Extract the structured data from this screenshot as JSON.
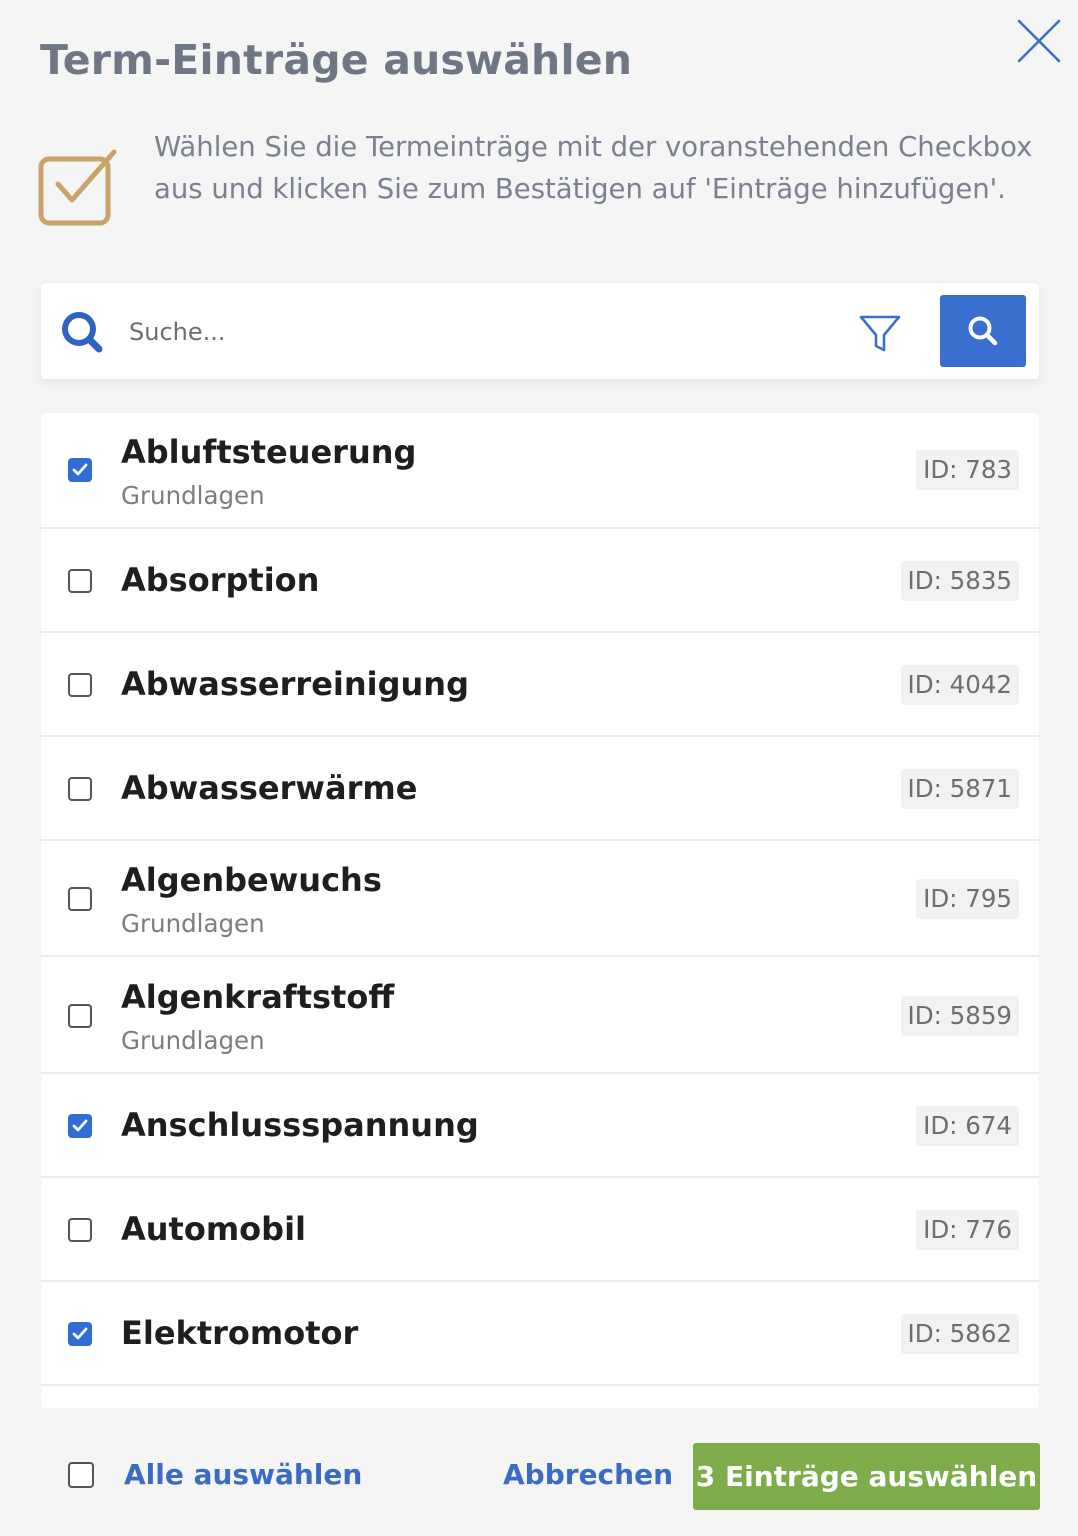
{
  "dialog": {
    "title": "Term-Einträge auswählen",
    "info_text": "Wählen Sie die Termeinträge mit der voranstehenden Checkbox aus und klicken Sie zum Bestätigen auf 'Einträge hinzufügen'."
  },
  "search": {
    "placeholder": "Suche..."
  },
  "colors": {
    "accent": "#3a6fcf",
    "confirm": "#7eac4b",
    "info_icon": "#c9a46a",
    "title": "#6f7684"
  },
  "icons": {
    "close": "close-icon",
    "info": "checkbox-outline-icon",
    "search": "search-icon",
    "filter": "filter-icon"
  },
  "items": [
    {
      "label": "Abluftsteuerung",
      "sub": "Grundlagen",
      "id": "ID: 783",
      "checked": true
    },
    {
      "label": "Absorption",
      "sub": "",
      "id": "ID: 5835",
      "checked": false
    },
    {
      "label": "Abwasserreinigung",
      "sub": "",
      "id": "ID: 4042",
      "checked": false
    },
    {
      "label": "Abwasserwärme",
      "sub": "",
      "id": "ID: 5871",
      "checked": false
    },
    {
      "label": "Algenbewuchs",
      "sub": "Grundlagen",
      "id": "ID: 795",
      "checked": false
    },
    {
      "label": "Algenkraftstoff",
      "sub": "Grundlagen",
      "id": "ID: 5859",
      "checked": false
    },
    {
      "label": "Anschlussspannung",
      "sub": "",
      "id": "ID: 674",
      "checked": true
    },
    {
      "label": "Automobil",
      "sub": "",
      "id": "ID: 776",
      "checked": false
    },
    {
      "label": "Elektromotor",
      "sub": "",
      "id": "ID: 5862",
      "checked": true
    }
  ],
  "footer": {
    "select_all_label": "Alle auswählen",
    "select_all_checked": false,
    "cancel_label": "Abbrechen",
    "confirm_label": "3 Einträge auswählen"
  }
}
